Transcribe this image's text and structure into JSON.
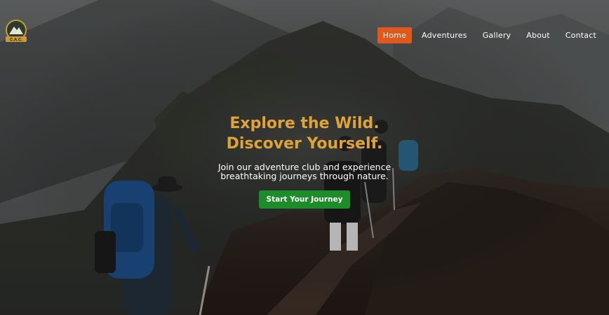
{
  "brand": {
    "logo_text": "C.A.C.",
    "logo_icon": "mountain-emblem-icon"
  },
  "nav": {
    "items": [
      {
        "label": "Home",
        "active": true
      },
      {
        "label": "Adventures",
        "active": false
      },
      {
        "label": "Gallery",
        "active": false
      },
      {
        "label": "About",
        "active": false
      },
      {
        "label": "Contact",
        "active": false
      }
    ]
  },
  "hero": {
    "headline_line1": "Explore the Wild.",
    "headline_line2": "Discover Yourself.",
    "subtext": "Join our adventure club and experience breathtaking journeys through nature.",
    "cta_label": "Start Your Journey"
  },
  "colors": {
    "accent_orange": "#e0581b",
    "headline_gold": "#e0a33a",
    "cta_green": "#1d8d2a"
  }
}
